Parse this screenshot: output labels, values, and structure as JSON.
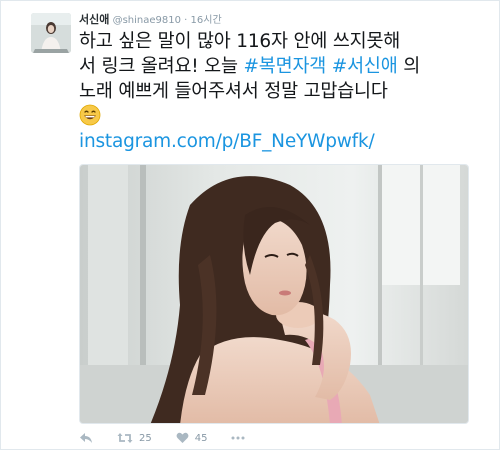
{
  "tweet": {
    "display_name": "서신애",
    "handle": "@shinae9810",
    "separator": "·",
    "time": "16시간",
    "text_line1": "하고 싶은 말이 많아 116자 안에 쓰지못해",
    "text_line2a": "서 링크 올려요! 오늘 ",
    "hashtag1": "#복면자객",
    "text_space": " ",
    "hashtag2": "#서신애",
    "text_line2b": " 의",
    "text_line3": "노래 예쁘게 들어주셔서 정말 고맙습니다",
    "link": "instagram.com/p/BF_NeYWpwfk/",
    "retweet_count": "25",
    "like_count": "45"
  },
  "icons": {
    "reply": "reply-icon",
    "retweet": "retweet-icon",
    "like": "heart-icon",
    "more": "more-icon"
  },
  "colors": {
    "link": "#1b95e0",
    "muted": "#8899a6",
    "text": "#14171a"
  }
}
